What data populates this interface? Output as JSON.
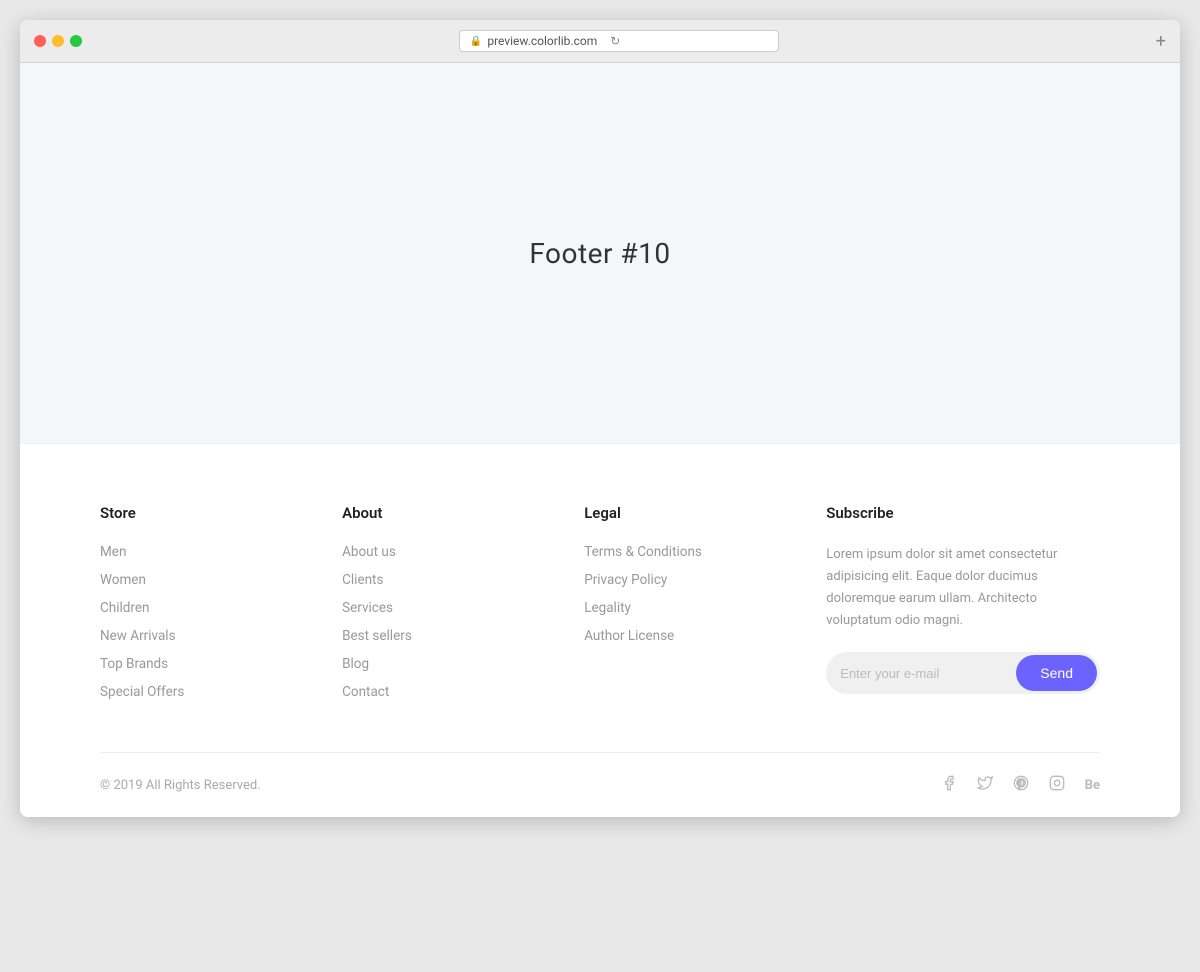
{
  "browser": {
    "url": "preview.colorlib.com",
    "new_tab_label": "+"
  },
  "page": {
    "title": "Footer #10"
  },
  "footer": {
    "store": {
      "heading": "Store",
      "links": [
        "Men",
        "Women",
        "Children",
        "New Arrivals",
        "Top Brands",
        "Special Offers"
      ]
    },
    "about": {
      "heading": "About",
      "links": [
        "About us",
        "Clients",
        "Services",
        "Best sellers",
        "Blog",
        "Contact"
      ]
    },
    "legal": {
      "heading": "Legal",
      "links": [
        "Terms & Conditions",
        "Privacy Policy",
        "Legality",
        "Author License"
      ]
    },
    "subscribe": {
      "heading": "Subscribe",
      "description": "Lorem ipsum dolor sit amet consectetur adipisicing elit. Eaque dolor ducimus doloremque earum ullam. Architecto voluptatum odio magni.",
      "email_placeholder": "Enter your e-mail",
      "send_label": "Send"
    },
    "bottom": {
      "copyright": "© 2019 All Rights Reserved."
    }
  }
}
